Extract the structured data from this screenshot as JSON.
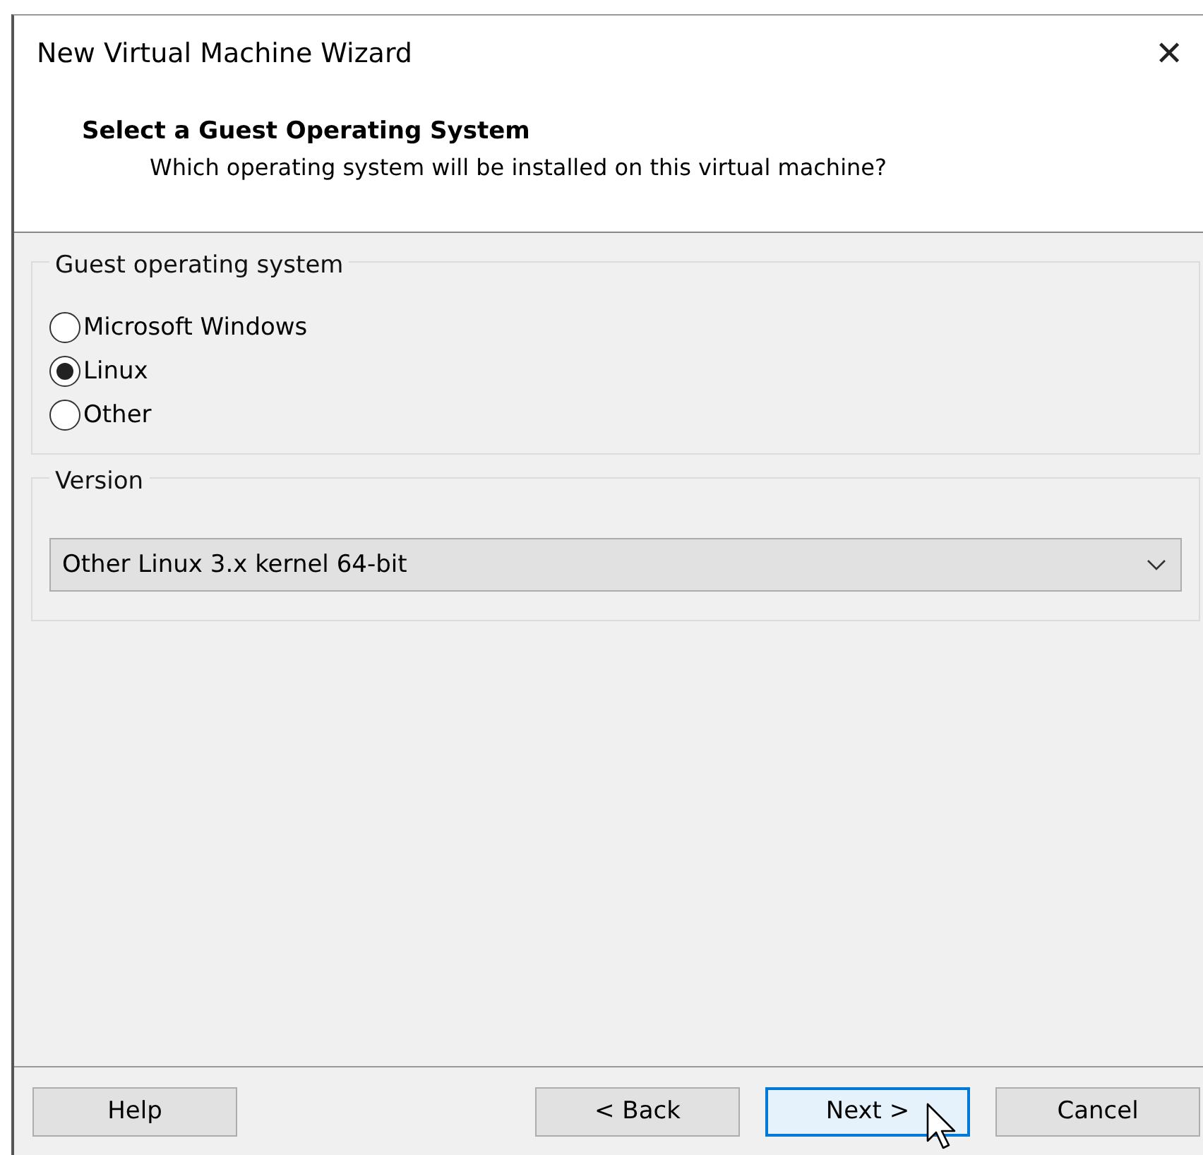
{
  "window": {
    "title": "New Virtual Machine Wizard",
    "close": "✕"
  },
  "header": {
    "title": "Select a Guest Operating System",
    "subtitle": "Which operating system will be installed on this virtual machine?"
  },
  "guest_os": {
    "label": "Guest operating system",
    "options": [
      {
        "label": "Microsoft Windows",
        "selected": false
      },
      {
        "label": "Linux",
        "selected": true
      },
      {
        "label": "Other",
        "selected": false
      }
    ]
  },
  "version": {
    "label": "Version",
    "value": "Other Linux 3.x kernel 64-bit"
  },
  "buttons": [
    {
      "label": "Help",
      "kind": "help",
      "default": false
    },
    {
      "label": "< Back",
      "kind": "back",
      "default": false
    },
    {
      "label": "Next >",
      "kind": "next",
      "default": true
    },
    {
      "label": "Cancel",
      "kind": "cancel",
      "default": false
    }
  ]
}
